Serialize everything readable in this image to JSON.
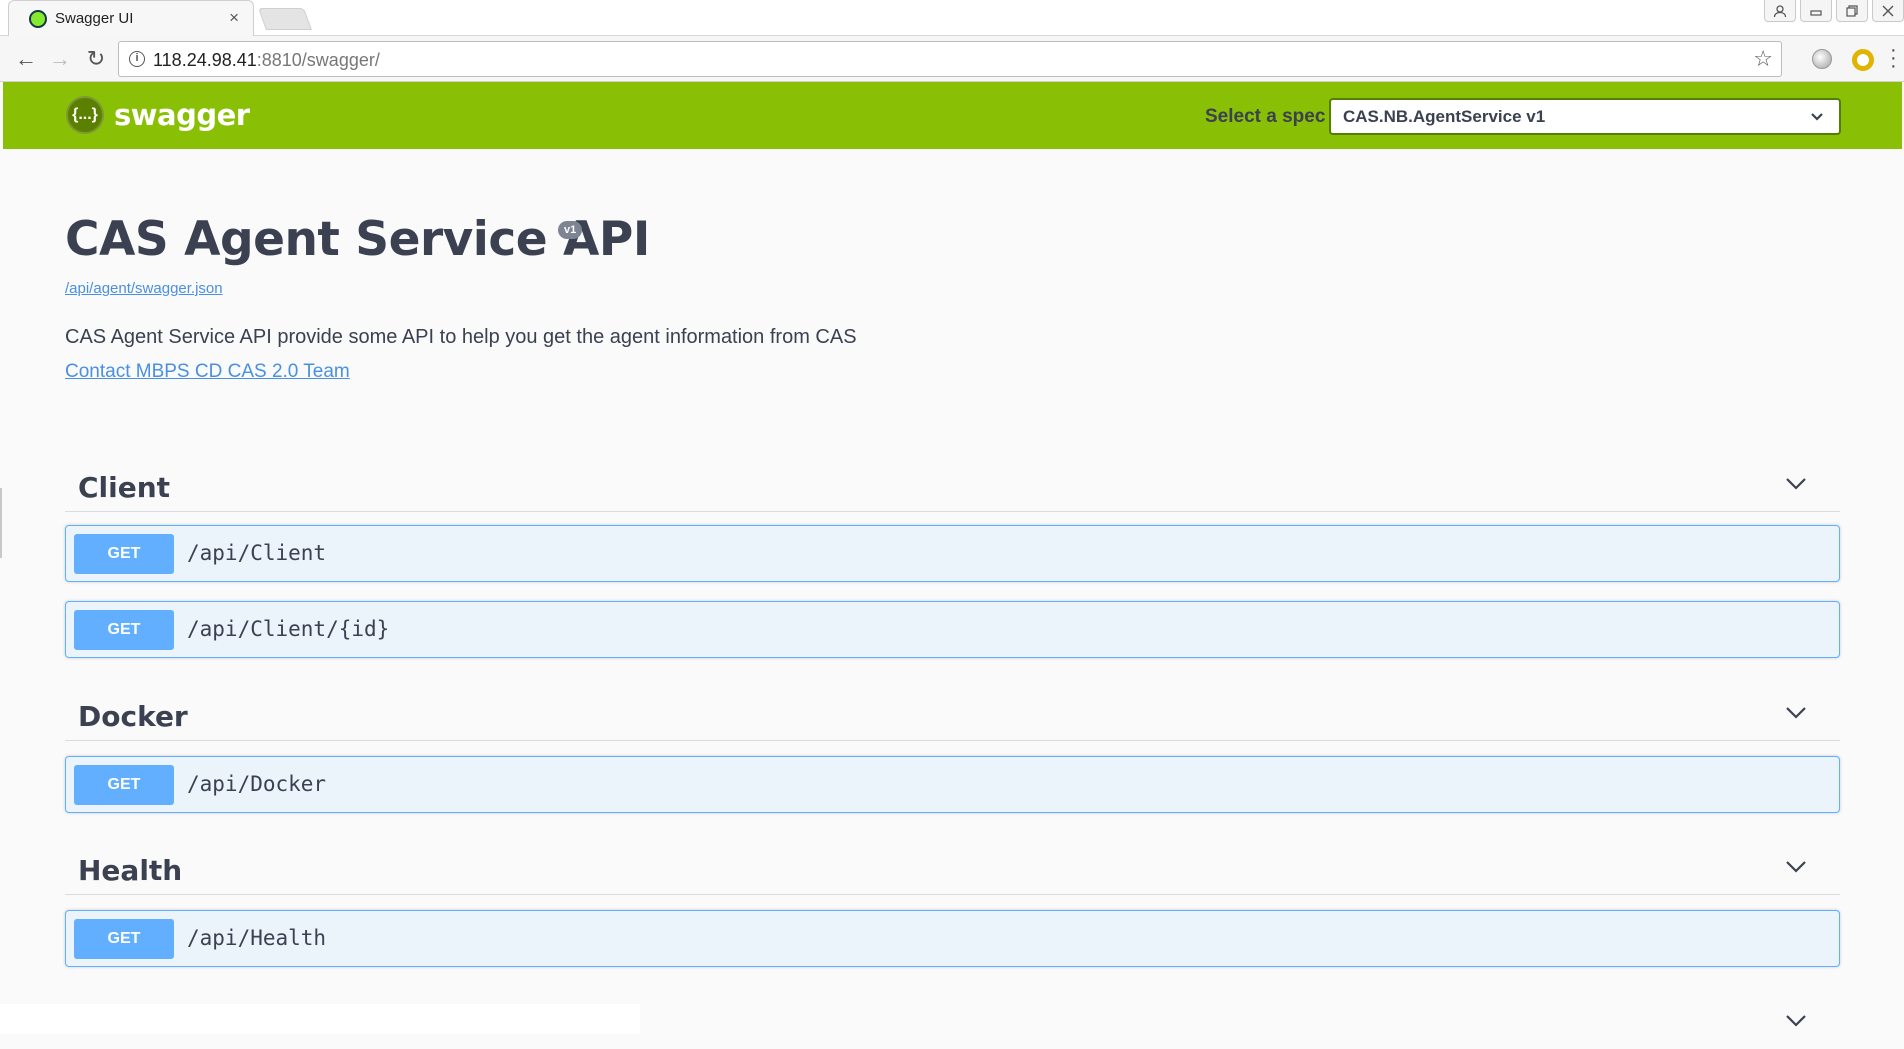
{
  "browser": {
    "tab_title": "Swagger UI",
    "tab_close": "×",
    "url_host": "118.24.98.41",
    "url_rest": ":8810/swagger/",
    "back_icon": "←",
    "forward_icon": "→",
    "reload_icon": "↻",
    "star_icon": "☆",
    "window_buttons": [
      "user",
      "minimize",
      "restore",
      "close"
    ]
  },
  "topbar": {
    "logo_text": "swagger",
    "logo_mark": "{...}",
    "select_label": "Select a spec",
    "selected_spec": "CAS.NB.AgentService v1",
    "accent_color": "#89bf04"
  },
  "info": {
    "title": "CAS Agent Service API",
    "version": "v1",
    "spec_url": "/api/agent/swagger.json",
    "description": "CAS Agent Service API provide some API to help you get the agent information from CAS",
    "contact": "Contact MBPS CD CAS 2.0 Team"
  },
  "groups": [
    {
      "name": "Client",
      "operations": [
        {
          "method": "GET",
          "path": "/api/Client"
        },
        {
          "method": "GET",
          "path": "/api/Client/{id}"
        }
      ]
    },
    {
      "name": "Docker",
      "operations": [
        {
          "method": "GET",
          "path": "/api/Docker"
        }
      ]
    },
    {
      "name": "Health",
      "operations": [
        {
          "method": "GET",
          "path": "/api/Health"
        }
      ]
    }
  ],
  "colors": {
    "get_method": "#61affe",
    "get_bg": "#ebf3fb",
    "text": "#3b4151",
    "link": "#4990e2"
  }
}
